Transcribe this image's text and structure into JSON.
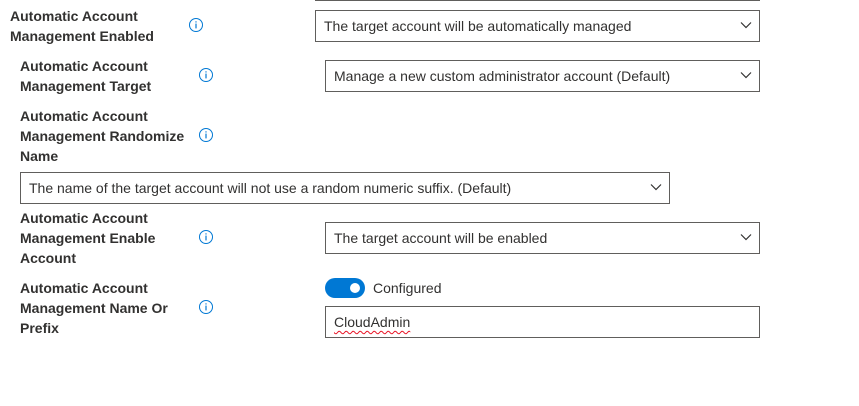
{
  "settings": {
    "enabled": {
      "label_lines": [
        "Automatic Account",
        "Management Enabled"
      ],
      "value": "The target account will be automatically managed"
    },
    "target": {
      "label_lines": [
        "Automatic Account",
        "Management Target"
      ],
      "value": "Manage a new custom administrator account (Default)"
    },
    "randomize": {
      "label_lines": [
        "Automatic Account",
        "Management Randomize",
        "Name"
      ],
      "value": "The name of the target account will not use a random numeric suffix. (Default)"
    },
    "enable_account": {
      "label_lines": [
        "Automatic Account",
        "Management Enable",
        "Account"
      ],
      "value": "The target account will be enabled"
    },
    "name_prefix": {
      "label_lines": [
        "Automatic Account",
        "Management Name Or",
        "Prefix"
      ],
      "toggle_label": "Configured",
      "toggle_on": true,
      "value": "CloudAdmin"
    }
  },
  "icons": {
    "info": "info-icon",
    "dropdown": "chevron-down-icon"
  },
  "colors": {
    "accent": "#0078d4",
    "border": "#605e5c",
    "text": "#323130",
    "spellcheck": "#e81123"
  }
}
